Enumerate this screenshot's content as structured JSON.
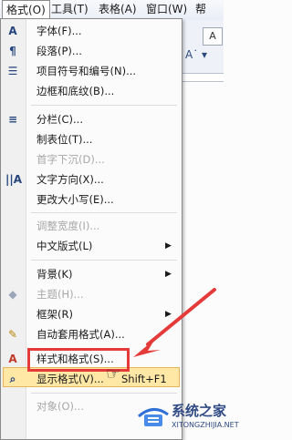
{
  "menubar": {
    "items": [
      {
        "label": "格式(O)",
        "active": true
      },
      {
        "label": "工具(T)"
      },
      {
        "label": "表格(A)"
      },
      {
        "label": "窗口(W)"
      },
      {
        "label": "帮"
      }
    ]
  },
  "toolbar": {
    "box_text": "A",
    "icon_text": "A˙ ▾"
  },
  "format_menu": {
    "items": [
      {
        "icon": "A",
        "icon_name": "font-icon",
        "label": "字体(F)..."
      },
      {
        "icon": "¶",
        "icon_name": "paragraph-icon",
        "label": "段落(P)..."
      },
      {
        "icon": "☰",
        "icon_name": "list-icon",
        "label": "项目符号和编号(N)..."
      },
      {
        "icon": "",
        "label": "边框和底纹(B)..."
      },
      {
        "icon": "≡",
        "icon_name": "columns-icon",
        "label": "分栏(C)..."
      },
      {
        "icon": "",
        "label": "制表位(T)..."
      },
      {
        "icon": "",
        "label": "首字下沉(D)...",
        "disabled": true
      },
      {
        "icon": "||A",
        "icon_name": "text-direction-icon",
        "label": "文字方向(X)..."
      },
      {
        "icon": "",
        "label": "更改大小写(E)..."
      },
      {
        "icon": "",
        "label": "调整宽度(I)...",
        "disabled": true
      },
      {
        "icon": "",
        "label": "中文版式(L)",
        "submenu": true
      },
      {
        "icon": "",
        "label": "背景(K)",
        "submenu": true
      },
      {
        "icon": "◆",
        "icon_name": "theme-icon",
        "label": "主题(H)...",
        "disabled": true
      },
      {
        "icon": "",
        "label": "框架(R)",
        "submenu": true
      },
      {
        "icon": "✎",
        "icon_name": "autoformat-icon",
        "label": "自动套用格式(A)..."
      },
      {
        "icon": "A",
        "icon_name": "styles-icon",
        "label": "样式和格式(S)..."
      },
      {
        "icon": "⌕",
        "icon_name": "reveal-format-icon",
        "label": "显示格式(V)...",
        "shortcut": "Shift+F1"
      },
      {
        "icon": "",
        "label": "对象(O)...",
        "disabled": true
      }
    ]
  },
  "watermark": {
    "title": "系统之家",
    "url": "XITONGZHIJIA.NET"
  }
}
